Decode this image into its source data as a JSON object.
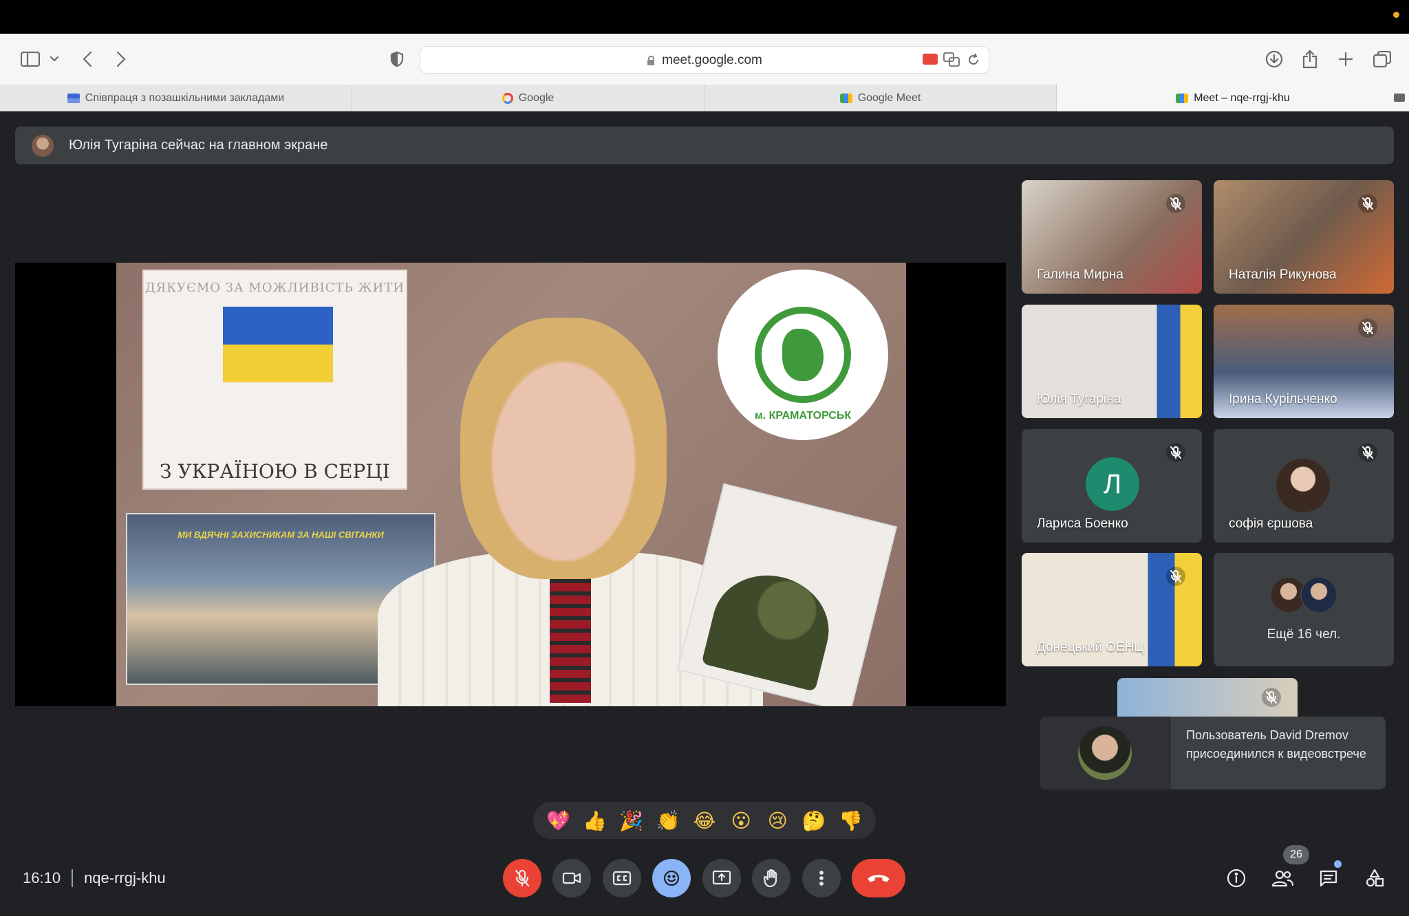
{
  "browser": {
    "url": "meet.google.com",
    "tabs": [
      {
        "label": "Співпраця з позашкільними закладами",
        "favicon": "flag-icon"
      },
      {
        "label": "Google",
        "favicon": "google-icon"
      },
      {
        "label": "Google Meet",
        "favicon": "meet-icon"
      },
      {
        "label": "Meet – nqe-rrgj-khu",
        "favicon": "meet-icon",
        "active": true
      }
    ]
  },
  "banner": {
    "text": "Юлія Тугаріна сейчас на главном экране"
  },
  "main_video": {
    "poster_top_title": "ДЯКУЄМО ЗА МОЖЛИВІСТЬ ЖИТИ",
    "poster_top_bottom": "З УКРАЇНОЮ В СЕРЦІ",
    "poster_bottom_title": "МИ ВДЯЧНІ ЗАХИСНИКАМ ЗА НАШІ СВІТАНКИ",
    "emblem_text": "м. КРАМАТОРСЬК"
  },
  "participants": [
    {
      "name": "Галина Мирна",
      "muted": true
    },
    {
      "name": "Наталія Рикунова",
      "muted": true
    },
    {
      "name": "Юлія Тугаріна",
      "muted": false
    },
    {
      "name": "Ірина Курільченко",
      "muted": true
    },
    {
      "name": "Лариса Боенко",
      "muted": true,
      "initial": "Л"
    },
    {
      "name": "софія єршова",
      "muted": true
    },
    {
      "name": "Донецький ОЕНЦ",
      "muted": true
    }
  ],
  "more_participants": "Ещё 16 чел.",
  "toast": {
    "text": "Пользователь David Dremov присоединился к видеовстрече"
  },
  "reactions": [
    "💖",
    "👍",
    "🎉",
    "👏",
    "😂",
    "😮",
    "😢",
    "🤔",
    "👎"
  ],
  "meeting": {
    "time": "16:10",
    "code": "nqe-rrgj-khu",
    "participant_count": "26"
  },
  "colors": {
    "background": "#202124",
    "tile": "#3c4043",
    "danger": "#ea4335",
    "accent": "#8ab4f8"
  }
}
